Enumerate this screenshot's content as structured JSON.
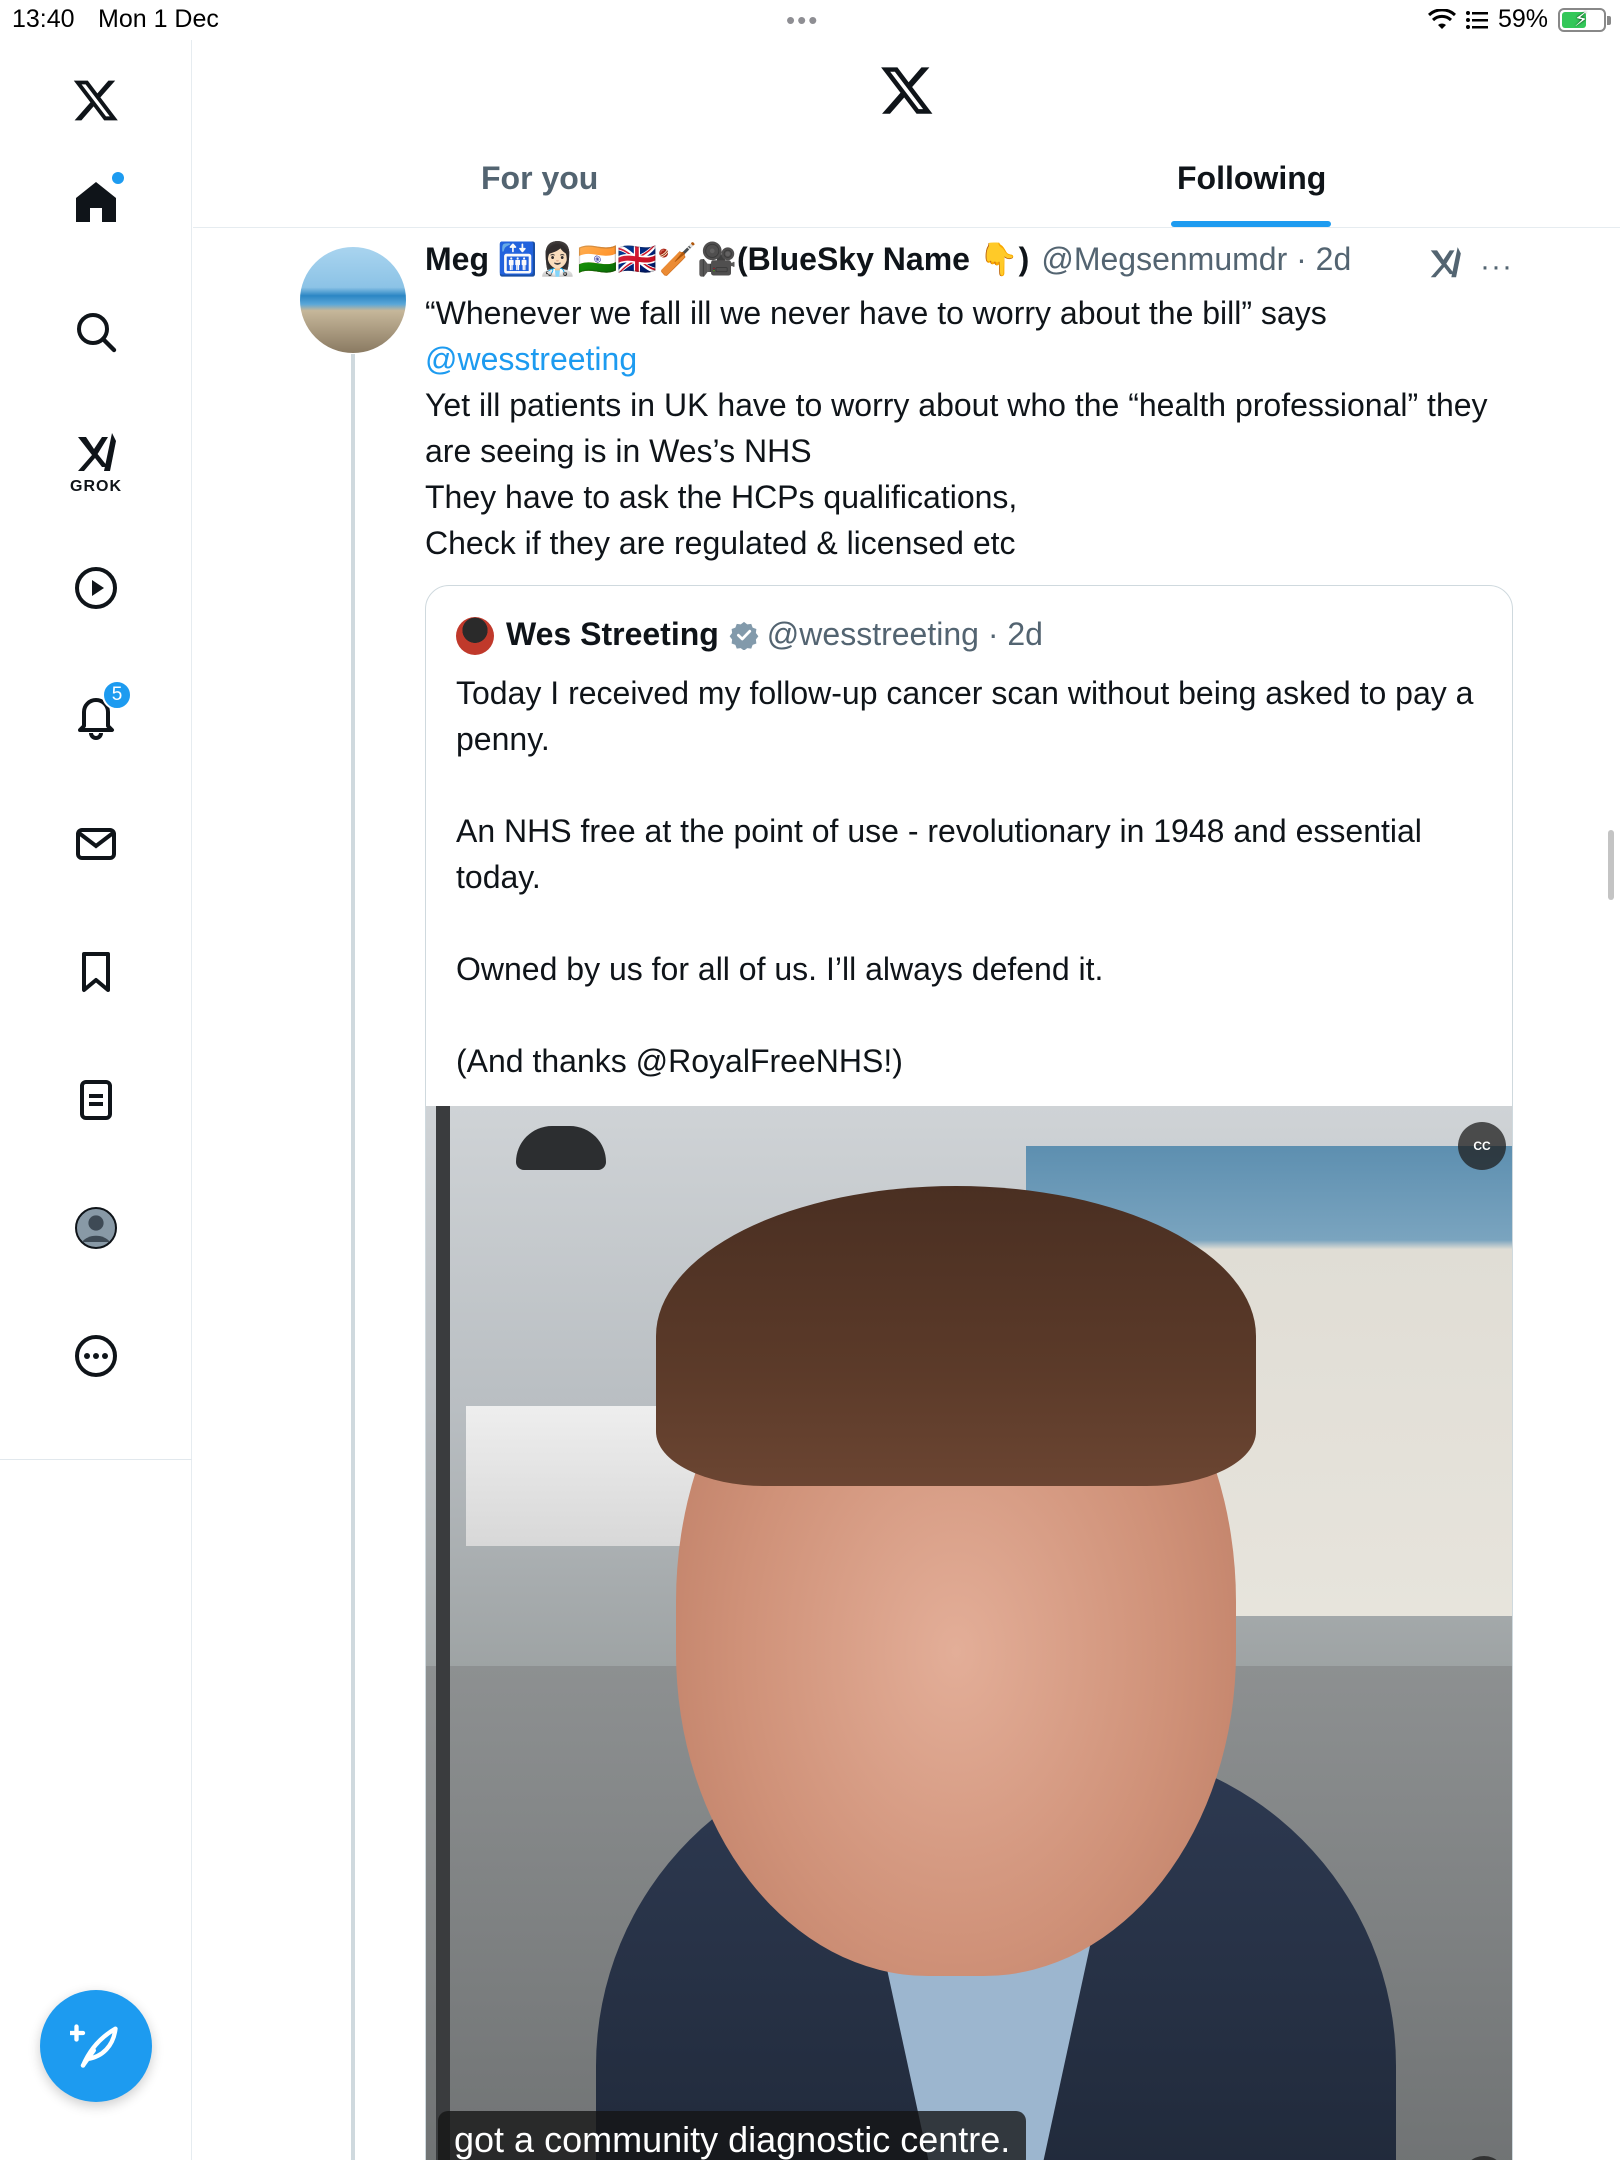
{
  "status_bar": {
    "time": "13:40",
    "date": "Mon 1 Dec",
    "dots": "•••",
    "battery_percent": "59%",
    "battery_level": 0.59
  },
  "sidebar": {
    "grok_label": "GROK",
    "notifications_count": "5"
  },
  "header": {
    "tabs": [
      {
        "label": "For you",
        "selected": false
      },
      {
        "label": "Following",
        "selected": true
      }
    ]
  },
  "tweet": {
    "author_name": "Meg 🛗👩🏻‍⚕️🇮🇳🇬🇧🏏🎥(BlueSky Name 👇)",
    "handle_time": "@Megsenmumdr · 2d",
    "more": "···",
    "text_line1": "“Whenever we fall ill we never have to worry about the bill” says",
    "mention": "@wesstreeting",
    "text_line2": "Yet ill patients in UK have to worry about who the “health professional” they are seeing is in Wes’s NHS",
    "text_line3": "They have to ask the HCPs qualifications,",
    "text_line4": "Check if they are regulated & licensed etc"
  },
  "quoted_tweet": {
    "author_name": "Wes Streeting",
    "handle_time": "@wesstreeting · 2d",
    "paragraphs": [
      "Today I received my follow-up cancer scan without being asked to pay a penny.",
      "An NHS free at the point of use - revolutionary in 1948 and essential today.",
      "Owned by us for all of us. I’ll always defend it.",
      "(And thanks @RoyalFreeNHS!)"
    ],
    "video": {
      "caption": "got a community diagnostic centre.",
      "cc_label": "CC"
    }
  },
  "colors": {
    "accent": "#1d9bf0",
    "text_primary": "#0f1419",
    "text_secondary": "#536471",
    "border": "#cfd9de"
  }
}
